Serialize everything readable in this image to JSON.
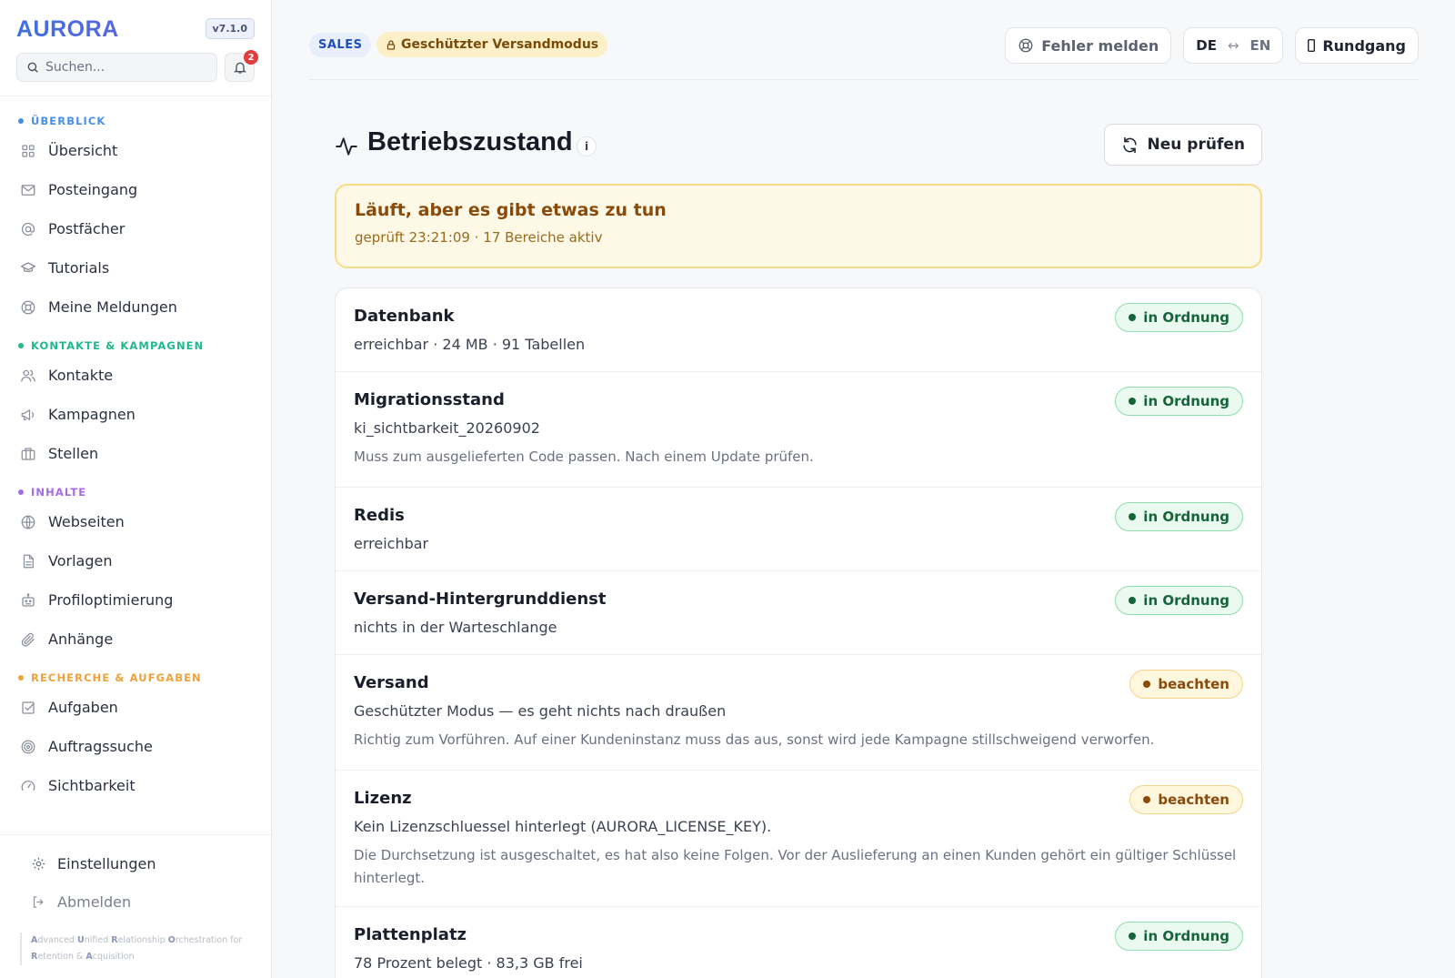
{
  "app": {
    "logo": "AURORA",
    "version": "v7.1.0",
    "search_placeholder": "Suchen...",
    "notifications_count": "2",
    "tagline_parts": [
      {
        "t": "A",
        "b": true
      },
      {
        "t": "dvanced ",
        "b": false
      },
      {
        "t": "U",
        "b": true
      },
      {
        "t": "nified ",
        "b": false
      },
      {
        "t": "R",
        "b": true
      },
      {
        "t": "elationship ",
        "b": false
      },
      {
        "t": "O",
        "b": true
      },
      {
        "t": "rchestration for ",
        "b": false
      },
      {
        "t": "R",
        "b": true
      },
      {
        "t": "etention & ",
        "b": false
      },
      {
        "t": "A",
        "b": true
      },
      {
        "t": "cquisition",
        "b": false
      }
    ]
  },
  "sidebar": {
    "sections": [
      {
        "label": "ÜBERBLICK",
        "color": "#4a8ee8",
        "items": [
          {
            "label": "Übersicht",
            "icon": "grid-icon"
          },
          {
            "label": "Posteingang",
            "icon": "mail-icon"
          },
          {
            "label": "Postfächer",
            "icon": "at-icon"
          },
          {
            "label": "Tutorials",
            "icon": "graduation-icon"
          },
          {
            "label": "Meine Meldungen",
            "icon": "lifebuoy-icon"
          }
        ]
      },
      {
        "label": "KONTAKTE & KAMPAGNEN",
        "color": "#1fb98a",
        "items": [
          {
            "label": "Kontakte",
            "icon": "users-icon"
          },
          {
            "label": "Kampagnen",
            "icon": "megaphone-icon"
          },
          {
            "label": "Stellen",
            "icon": "briefcase-icon"
          }
        ]
      },
      {
        "label": "INHALTE",
        "color": "#a36be6",
        "items": [
          {
            "label": "Webseiten",
            "icon": "globe-icon"
          },
          {
            "label": "Vorlagen",
            "icon": "file-icon"
          },
          {
            "label": "Profiloptimierung",
            "icon": "robot-icon"
          },
          {
            "label": "Anhänge",
            "icon": "paperclip-icon"
          }
        ]
      },
      {
        "label": "RECHERCHE & AUFGABEN",
        "color": "#f0a23a",
        "items": [
          {
            "label": "Aufgaben",
            "icon": "checkbox-icon"
          },
          {
            "label": "Auftragssuche",
            "icon": "target-icon"
          },
          {
            "label": "Sichtbarkeit",
            "icon": "gauge-icon"
          }
        ]
      }
    ],
    "footer": {
      "settings": "Einstellungen",
      "logout": "Abmelden"
    }
  },
  "topbar": {
    "sales_badge": "SALES",
    "mode_badge": "Geschützter Versandmodus",
    "report_button": "Fehler melden",
    "lang_de": "DE",
    "lang_arrow": "↔",
    "lang_en": "EN",
    "tour_button": "Rundgang"
  },
  "page": {
    "title": "Betriebszustand",
    "info": "i",
    "recheck_button": "Neu prüfen",
    "alert_title": "Läuft, aber es gibt etwas zu tun",
    "alert_sub": "geprüft 23:21:09 · 17 Bereiche aktiv"
  },
  "checks": [
    {
      "title": "Datenbank",
      "detail": "erreichbar · 24 MB · 91 Tabellen",
      "note": "",
      "status": "in Ordnung",
      "kind": "ok"
    },
    {
      "title": "Migrationsstand",
      "detail": "ki_sichtbarkeit_20260902",
      "note": "Muss zum ausgelieferten Code passen. Nach einem Update prüfen.",
      "status": "in Ordnung",
      "kind": "ok"
    },
    {
      "title": "Redis",
      "detail": "erreichbar",
      "note": "",
      "status": "in Ordnung",
      "kind": "ok"
    },
    {
      "title": "Versand-Hintergrunddienst",
      "detail": "nichts in der Warteschlange",
      "note": "",
      "status": "in Ordnung",
      "kind": "ok"
    },
    {
      "title": "Versand",
      "detail": "Geschützter Modus — es geht nichts nach draußen",
      "note": "Richtig zum Vorführen. Auf einer Kundeninstanz muss das aus, sonst wird jede Kampagne stillschweigend verworfen.",
      "status": "beachten",
      "kind": "warn"
    },
    {
      "title": "Lizenz",
      "detail": "Kein Lizenzschluessel hinterlegt (AURORA_LICENSE_KEY).",
      "note": "Die Durchsetzung ist ausgeschaltet, es hat also keine Folgen. Vor der Auslieferung an einen Kunden gehört ein gültiger Schlüssel hinterlegt.",
      "status": "beachten",
      "kind": "warn"
    },
    {
      "title": "Plattenplatz",
      "detail": "78 Prozent belegt · 83,3 GB frei",
      "note": "",
      "status": "in Ordnung",
      "kind": "ok"
    }
  ]
}
